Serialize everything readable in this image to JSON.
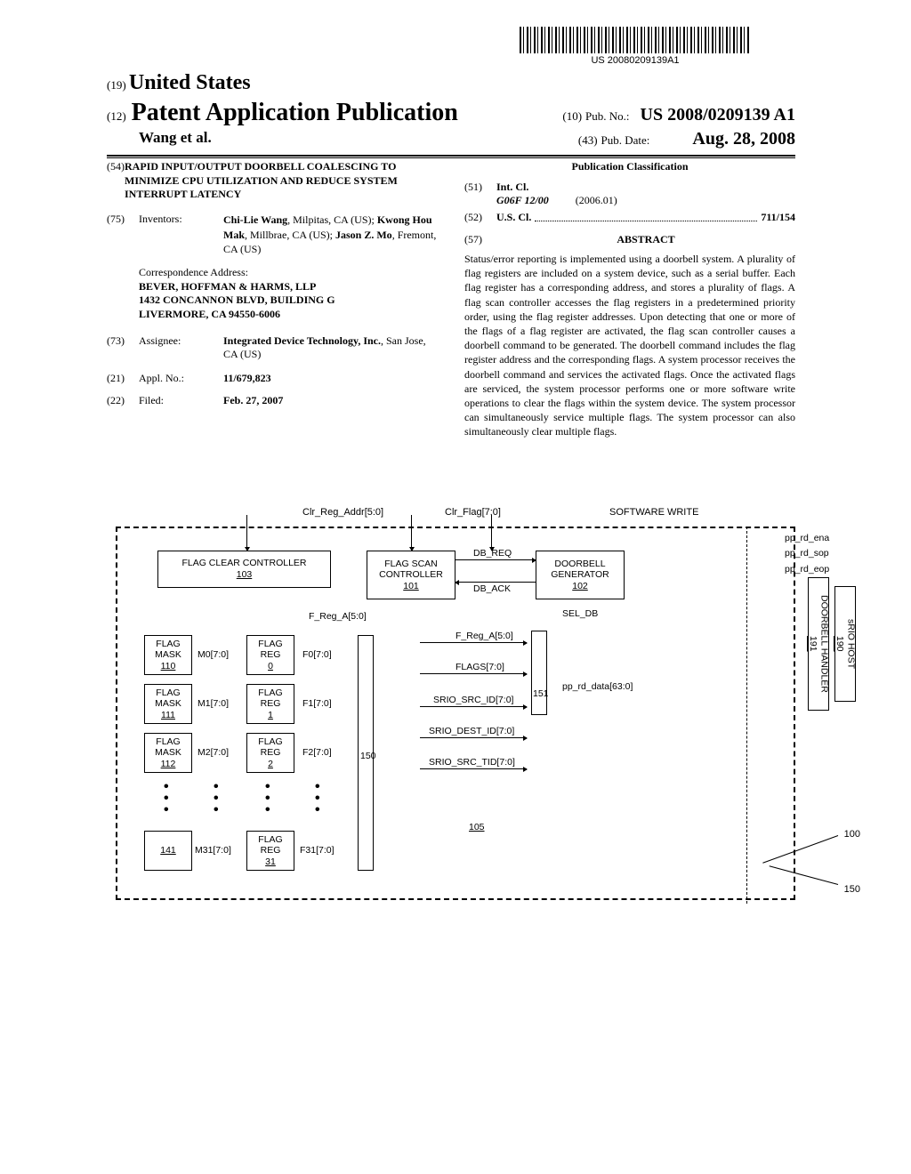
{
  "barcode_id": "US 20080209139A1",
  "header": {
    "code19": "(19)",
    "country": "United States",
    "code12": "(12)",
    "pub_type": "Patent Application Publication",
    "code10": "(10)",
    "pub_no_label": "Pub. No.:",
    "pub_no": "US 2008/0209139 A1",
    "authors": "Wang et al.",
    "code43": "(43)",
    "pub_date_label": "Pub. Date:",
    "pub_date": "Aug. 28, 2008"
  },
  "biblio": {
    "code54": "(54)",
    "title": "RAPID INPUT/OUTPUT DOORBELL COALESCING TO MINIMIZE CPU UTILIZATION AND REDUCE SYSTEM INTERRUPT LATENCY",
    "code75": "(75)",
    "inventors_label": "Inventors:",
    "inventors": "Chi-Lie Wang, Milpitas, CA (US); Kwong Hou Mak, Millbrae, CA (US); Jason Z. Mo, Fremont, CA (US)",
    "corr_label": "Correspondence Address:",
    "corr_name": "BEVER, HOFFMAN & HARMS, LLP",
    "corr_street": "1432 CONCANNON BLVD, BUILDING G",
    "corr_city": "LIVERMORE, CA 94550-6006",
    "code73": "(73)",
    "assignee_label": "Assignee:",
    "assignee": "Integrated Device Technology, Inc., San Jose, CA (US)",
    "code21": "(21)",
    "appl_label": "Appl. No.:",
    "appl_no": "11/679,823",
    "code22": "(22)",
    "filed_label": "Filed:",
    "filed_date": "Feb. 27, 2007"
  },
  "classification": {
    "title": "Publication Classification",
    "code51": "(51)",
    "intcl_label": "Int. Cl.",
    "intcl_code": "G06F 12/00",
    "intcl_date": "(2006.01)",
    "code52": "(52)",
    "uscl_label": "U.S. Cl.",
    "uscl_val": "711/154",
    "code57": "(57)",
    "abstract_label": "ABSTRACT",
    "abstract": "Status/error reporting is implemented using a doorbell system. A plurality of flag registers are included on a system device, such as a serial buffer. Each flag register has a corresponding address, and stores a plurality of flags. A flag scan controller accesses the flag registers in a predetermined priority order, using the flag register addresses. Upon detecting that one or more of the flags of a flag register are activated, the flag scan controller causes a doorbell command to be generated. The doorbell command includes the flag register address and the corresponding flags. A system processor receives the doorbell command and services the activated flags. Once the activated flags are serviced, the system processor performs one or more software write operations to clear the flags within the system device. The system processor can simultaneously service multiple flags. The system processor can also simultaneously clear multiple flags."
  },
  "diagram": {
    "top_sig1": "Clr_Reg_Addr[5:0]",
    "top_sig2": "Clr_Flag[7:0]",
    "top_sig3": "SOFTWARE WRITE",
    "blocks": {
      "flag_clear": "FLAG CLEAR CONTROLLER",
      "flag_clear_ref": "103",
      "flag_scan": "FLAG SCAN CONTROLLER",
      "flag_scan_ref": "101",
      "doorbell_gen": "DOORBELL GENERATOR",
      "doorbell_gen_ref": "102",
      "doorbell_handler": "DOORBELL HANDLER",
      "doorbell_handler_ref": "191",
      "srio_host": "sRIO HOST",
      "srio_host_ref": "190",
      "mask0": "FLAG MASK",
      "mask0_ref": "110",
      "mask1": "FLAG MASK",
      "mask1_ref": "111",
      "mask2": "FLAG MASK",
      "mask2_ref": "112",
      "mask31_ref": "141",
      "reg0": "FLAG REG",
      "reg0_ref": "0",
      "reg1": "FLAG REG",
      "reg1_ref": "1",
      "reg2": "FLAG REG",
      "reg2_ref": "2",
      "reg31": "FLAG REG",
      "reg31_ref": "31"
    },
    "signals": {
      "db_req": "DB_REQ",
      "db_ack": "DB_ACK",
      "sel_db": "SEL_DB",
      "f_reg_a": "F_Reg_A[5:0]",
      "flags": "FLAGS[7:0]",
      "srio_src_id": "SRIO_SRC_ID[7:0]",
      "srio_dest_id": "SRIO_DEST_ID[7:0]",
      "srio_src_tid": "SRIO_SRC_TID[7:0]",
      "m0": "M0[7:0]",
      "f0": "F0[7:0]",
      "m1": "M1[7:0]",
      "f1": "F1[7:0]",
      "m2": "M2[7:0]",
      "f2": "F2[7:0]",
      "m31": "M31[7:0]",
      "f31": "F31[7:0]",
      "pp_rd_ena": "pp_rd_ena",
      "pp_rd_sop": "pp_rd_sop",
      "pp_rd_eop": "pp_rd_eop",
      "pp_rd_data": "pp_rd_data[63:0]",
      "mux_150": "150",
      "mux_151": "151",
      "reg_105": "105",
      "label_100": "100",
      "label_150b": "150"
    }
  }
}
